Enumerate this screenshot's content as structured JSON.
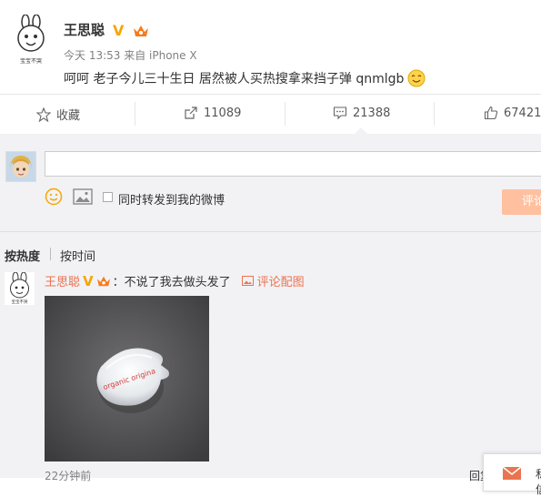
{
  "post": {
    "author": "王思聪",
    "meta": "今天 13:53 来自 iPhone X",
    "text": "呵呵 老子今儿三十生日 居然被人买热搜拿来挡子弹 qnmlgb"
  },
  "actions": {
    "favorite_label": "收藏",
    "repost_count": "11089",
    "comment_count": "21388",
    "like_count": "67421"
  },
  "composer": {
    "input_value": "",
    "repost_label": "同时转发到我的微博",
    "submit_label": "评论"
  },
  "sort": {
    "hot_label": "按热度",
    "time_label": "按时间"
  },
  "comment": {
    "author": "王思聪",
    "text": "：不说了我去做头发了",
    "pic_link": "评论配图",
    "time": "22分钟前",
    "reply_label": "回复",
    "photo_alt_text": "organic origina"
  },
  "chat": {
    "label": "私信"
  },
  "colors": {
    "link_orange": "#eb7350",
    "verified_gold": "#f7a600",
    "submit_disabled": "#ffc09f",
    "panel_bg": "#f2f2f5"
  }
}
